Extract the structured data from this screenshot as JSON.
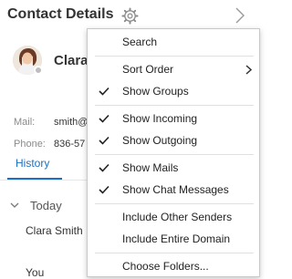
{
  "header": {
    "title": "Contact Details",
    "settings_icon": "gear-icon",
    "next_icon": "chevron-right-icon"
  },
  "contact": {
    "name": "Clara",
    "presence_color": "#bdbdbd"
  },
  "info": {
    "mail_label": "Mail:",
    "mail_value": "smith@",
    "phone_label": "Phone:",
    "phone_value": "836-57"
  },
  "tabs": {
    "history_label": "History",
    "accent": "#1c6fc2"
  },
  "history": {
    "group_label": "Today",
    "entry_name": "Clara Smith",
    "entry_you": "You"
  },
  "menu": {
    "items": [
      {
        "label": "Search",
        "checked": false
      },
      {
        "label": "Sort Order",
        "checked": false,
        "submenu": true
      },
      {
        "label": "Show Groups",
        "checked": true
      },
      {
        "label": "Show Incoming",
        "checked": true
      },
      {
        "label": "Show Outgoing",
        "checked": true
      },
      {
        "label": "Show Mails",
        "checked": true
      },
      {
        "label": "Show Chat Messages",
        "checked": true
      },
      {
        "label": "Include Other Senders",
        "checked": false
      },
      {
        "label": "Include Entire Domain",
        "checked": false
      },
      {
        "label": "Choose Folders...",
        "checked": false
      }
    ]
  }
}
